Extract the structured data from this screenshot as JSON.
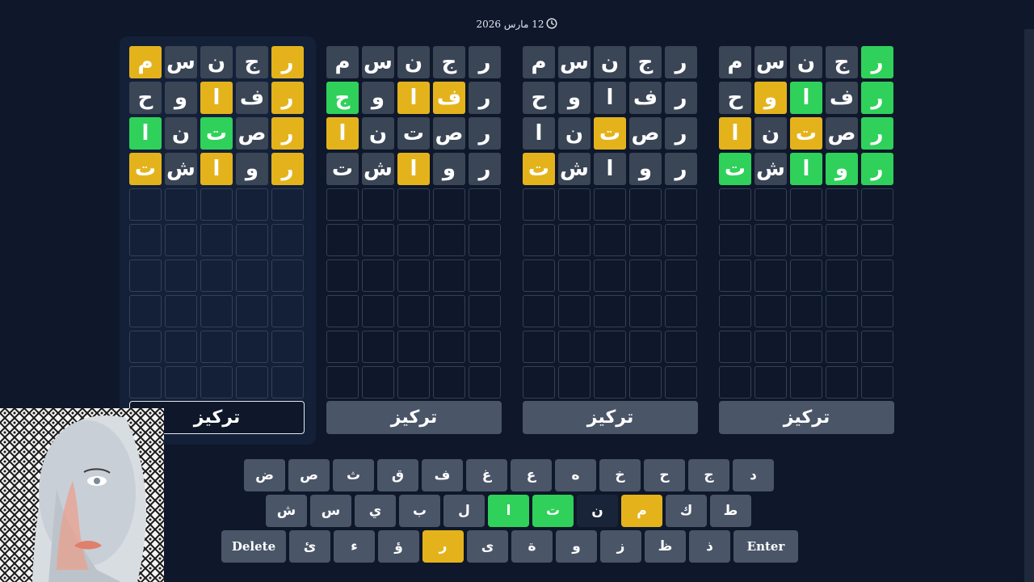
{
  "header": {
    "date": "12 مارس 2026",
    "clock_icon": "clock-icon"
  },
  "colors": {
    "background": "#0f172a",
    "tile_gray": "#3a4556",
    "tile_yellow": "#e4b31c",
    "tile_green": "#2fd15a",
    "key_default": "#4a5568"
  },
  "boards": [
    {
      "active": false,
      "focus_label": "تركيز",
      "rows": [
        [
          [
            "ر",
            "green"
          ],
          [
            "ج",
            "gray"
          ],
          [
            "ن",
            "gray"
          ],
          [
            "س",
            "gray"
          ],
          [
            "م",
            "gray"
          ]
        ],
        [
          [
            "ر",
            "green"
          ],
          [
            "ف",
            "gray"
          ],
          [
            "ا",
            "green"
          ],
          [
            "و",
            "yellow"
          ],
          [
            "ح",
            "gray"
          ]
        ],
        [
          [
            "ر",
            "green"
          ],
          [
            "ص",
            "gray"
          ],
          [
            "ت",
            "yellow"
          ],
          [
            "ن",
            "gray"
          ],
          [
            "ا",
            "yellow"
          ]
        ],
        [
          [
            "ر",
            "green"
          ],
          [
            "و",
            "green"
          ],
          [
            "ا",
            "green"
          ],
          [
            "ش",
            "gray"
          ],
          [
            "ت",
            "green"
          ]
        ]
      ]
    },
    {
      "active": false,
      "focus_label": "تركيز",
      "rows": [
        [
          [
            "ر",
            "gray"
          ],
          [
            "ج",
            "gray"
          ],
          [
            "ن",
            "gray"
          ],
          [
            "س",
            "gray"
          ],
          [
            "م",
            "gray"
          ]
        ],
        [
          [
            "ر",
            "gray"
          ],
          [
            "ف",
            "gray"
          ],
          [
            "ا",
            "gray"
          ],
          [
            "و",
            "gray"
          ],
          [
            "ح",
            "gray"
          ]
        ],
        [
          [
            "ر",
            "gray"
          ],
          [
            "ص",
            "gray"
          ],
          [
            "ت",
            "yellow"
          ],
          [
            "ن",
            "gray"
          ],
          [
            "ا",
            "gray"
          ]
        ],
        [
          [
            "ر",
            "gray"
          ],
          [
            "و",
            "gray"
          ],
          [
            "ا",
            "gray"
          ],
          [
            "ش",
            "gray"
          ],
          [
            "ت",
            "yellow"
          ]
        ]
      ]
    },
    {
      "active": false,
      "focus_label": "تركيز",
      "rows": [
        [
          [
            "ر",
            "gray"
          ],
          [
            "ج",
            "gray"
          ],
          [
            "ن",
            "gray"
          ],
          [
            "س",
            "gray"
          ],
          [
            "م",
            "gray"
          ]
        ],
        [
          [
            "ر",
            "gray"
          ],
          [
            "ف",
            "yellow"
          ],
          [
            "ا",
            "yellow"
          ],
          [
            "و",
            "gray"
          ],
          [
            "ج",
            "green"
          ]
        ],
        [
          [
            "ر",
            "gray"
          ],
          [
            "ص",
            "gray"
          ],
          [
            "ت",
            "gray"
          ],
          [
            "ن",
            "gray"
          ],
          [
            "ا",
            "yellow"
          ]
        ],
        [
          [
            "ر",
            "gray"
          ],
          [
            "و",
            "gray"
          ],
          [
            "ا",
            "yellow"
          ],
          [
            "ش",
            "gray"
          ],
          [
            "ت",
            "gray"
          ]
        ]
      ]
    },
    {
      "active": true,
      "focus_label": "تركيز",
      "rows": [
        [
          [
            "ر",
            "yellow"
          ],
          [
            "ج",
            "gray"
          ],
          [
            "ن",
            "gray"
          ],
          [
            "س",
            "gray"
          ],
          [
            "م",
            "yellow"
          ]
        ],
        [
          [
            "ر",
            "yellow"
          ],
          [
            "ف",
            "gray"
          ],
          [
            "ا",
            "yellow"
          ],
          [
            "و",
            "gray"
          ],
          [
            "ح",
            "gray"
          ]
        ],
        [
          [
            "ر",
            "yellow"
          ],
          [
            "ص",
            "gray"
          ],
          [
            "ت",
            "green"
          ],
          [
            "ن",
            "gray"
          ],
          [
            "ا",
            "green"
          ]
        ],
        [
          [
            "ر",
            "yellow"
          ],
          [
            "و",
            "gray"
          ],
          [
            "ا",
            "yellow"
          ],
          [
            "ش",
            "gray"
          ],
          [
            "ت",
            "yellow"
          ]
        ]
      ]
    }
  ],
  "keyboard": {
    "rows": [
      [
        [
          "د",
          "default"
        ],
        [
          "ج",
          "default"
        ],
        [
          "ح",
          "default"
        ],
        [
          "خ",
          "default"
        ],
        [
          "ه",
          "default"
        ],
        [
          "ع",
          "default"
        ],
        [
          "غ",
          "default"
        ],
        [
          "ف",
          "default"
        ],
        [
          "ق",
          "default"
        ],
        [
          "ث",
          "default"
        ],
        [
          "ص",
          "default"
        ],
        [
          "ض",
          "default"
        ]
      ],
      [
        [
          "ط",
          "default"
        ],
        [
          "ك",
          "default"
        ],
        [
          "م",
          "yellow"
        ],
        [
          "ن",
          "dark"
        ],
        [
          "ت",
          "green"
        ],
        [
          "ا",
          "green"
        ],
        [
          "ل",
          "default"
        ],
        [
          "ب",
          "default"
        ],
        [
          "ي",
          "default"
        ],
        [
          "س",
          "default"
        ],
        [
          "ش",
          "default"
        ]
      ],
      [
        [
          "Enter",
          "wide"
        ],
        [
          "ذ",
          "default"
        ],
        [
          "ظ",
          "default"
        ],
        [
          "ز",
          "default"
        ],
        [
          "و",
          "default"
        ],
        [
          "ة",
          "default"
        ],
        [
          "ى",
          "default"
        ],
        [
          "ر",
          "yellow"
        ],
        [
          "ؤ",
          "default"
        ],
        [
          "ء",
          "default"
        ],
        [
          "ئ",
          "default"
        ],
        [
          "Delete",
          "wide"
        ]
      ]
    ]
  }
}
